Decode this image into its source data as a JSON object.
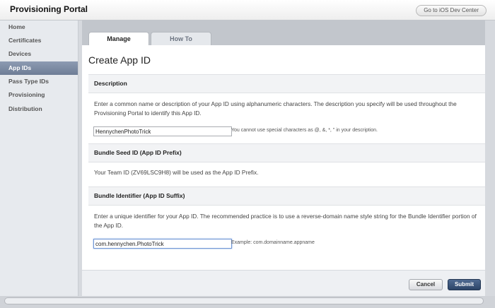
{
  "header": {
    "app_title": "Provisioning Portal",
    "dev_center_link": "Go to iOS Dev Center"
  },
  "sidebar": {
    "items": [
      {
        "label": "Home"
      },
      {
        "label": "Certificates"
      },
      {
        "label": "Devices"
      },
      {
        "label": "App IDs",
        "active": true
      },
      {
        "label": "Pass Type IDs"
      },
      {
        "label": "Provisioning"
      },
      {
        "label": "Distribution"
      }
    ]
  },
  "tabs": [
    {
      "label": "Manage",
      "active": true
    },
    {
      "label": "How To",
      "active": false
    }
  ],
  "page_title": "Create App ID",
  "sections": {
    "description": {
      "header": "Description",
      "text": "Enter a common name or description of your App ID using alphanumeric characters. The description you specify will be used throughout the Provisioning Portal to identify this App ID.",
      "input_value": "HennychenPhotoTrick",
      "hint": "You cannot use special characters as @, &, *, \" in your description."
    },
    "bundle_seed": {
      "header": "Bundle Seed ID (App ID Prefix)",
      "text": "Your Team ID (ZV69LSC9H8) will be used as the App ID Prefix."
    },
    "bundle_identifier": {
      "header": "Bundle Identifier (App ID Suffix)",
      "text": "Enter a unique identifier for your App ID. The recommended practice is to use a reverse-domain name style string for the Bundle Identifier portion of the App ID.",
      "input_value": "com.hennychen.PhotoTrick",
      "hint": "Example: com.domainname.appname"
    }
  },
  "actions": {
    "cancel_label": "Cancel",
    "submit_label": "Submit"
  },
  "colors": {
    "sidebar_active": "#7a88a0",
    "submit_button": "#34496b",
    "focus_ring": "#6f95d4"
  }
}
